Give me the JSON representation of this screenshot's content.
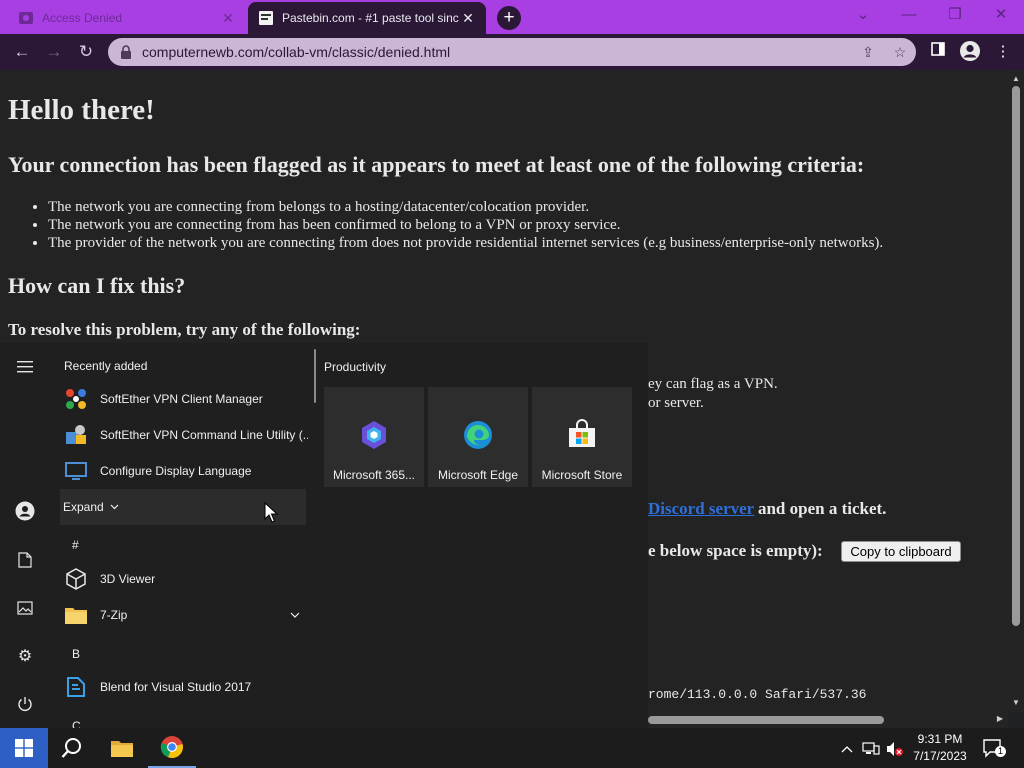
{
  "browser": {
    "tabs": [
      {
        "title": "Access Denied",
        "active": false
      },
      {
        "title": "Pastebin.com - #1 paste tool sinc",
        "active": true
      }
    ],
    "new_tab": "+",
    "url": "computernewb.com/collab-vm/classic/denied.html"
  },
  "page": {
    "h1": "Hello there!",
    "h2_criteria": "Your connection has been flagged as it appears to meet at least one of the following criteria:",
    "criteria": [
      "The network you are connecting from belongs to a hosting/datacenter/colocation provider.",
      "The network you are connecting from has been confirmed to belong to a VPN or proxy service.",
      "The provider of the network you are connecting from does not provide residential internet services (e.g business/enterprise-only networks)."
    ],
    "h2_fix": "How can I fix this?",
    "h3_resolve": "To resolve this problem, try any of the following:",
    "frag_vpn": "ey can flag as a VPN.",
    "frag_server": "or server.",
    "frag_link": "Discord server",
    "frag_ticket": "and open a ticket.",
    "frag_empty": "e below space is empty):",
    "copy_button": "Copy to clipboard",
    "user_agent": "rome/113.0.0.0 Safari/537.36"
  },
  "start_menu": {
    "recently_added": "Recently added",
    "recent_apps": [
      "SoftEther VPN Client Manager",
      "SoftEther VPN Command Line Utility (...",
      "Configure Display Language"
    ],
    "expand": "Expand",
    "letters": [
      "#",
      "B",
      "C"
    ],
    "apps_hash": [
      "3D Viewer",
      "7-Zip"
    ],
    "apps_b": [
      "Blend for Visual Studio 2017"
    ],
    "productivity": "Productivity",
    "tiles": [
      "Microsoft 365...",
      "Microsoft Edge",
      "Microsoft Store"
    ]
  },
  "taskbar": {
    "time": "9:31 PM",
    "date": "7/17/2023",
    "notifications": "1"
  },
  "colors": {
    "tab_strip": "#a83fe3",
    "toolbar": "#2b1736",
    "start_button": "#2e5fc4",
    "link": "#2f6fd8"
  }
}
